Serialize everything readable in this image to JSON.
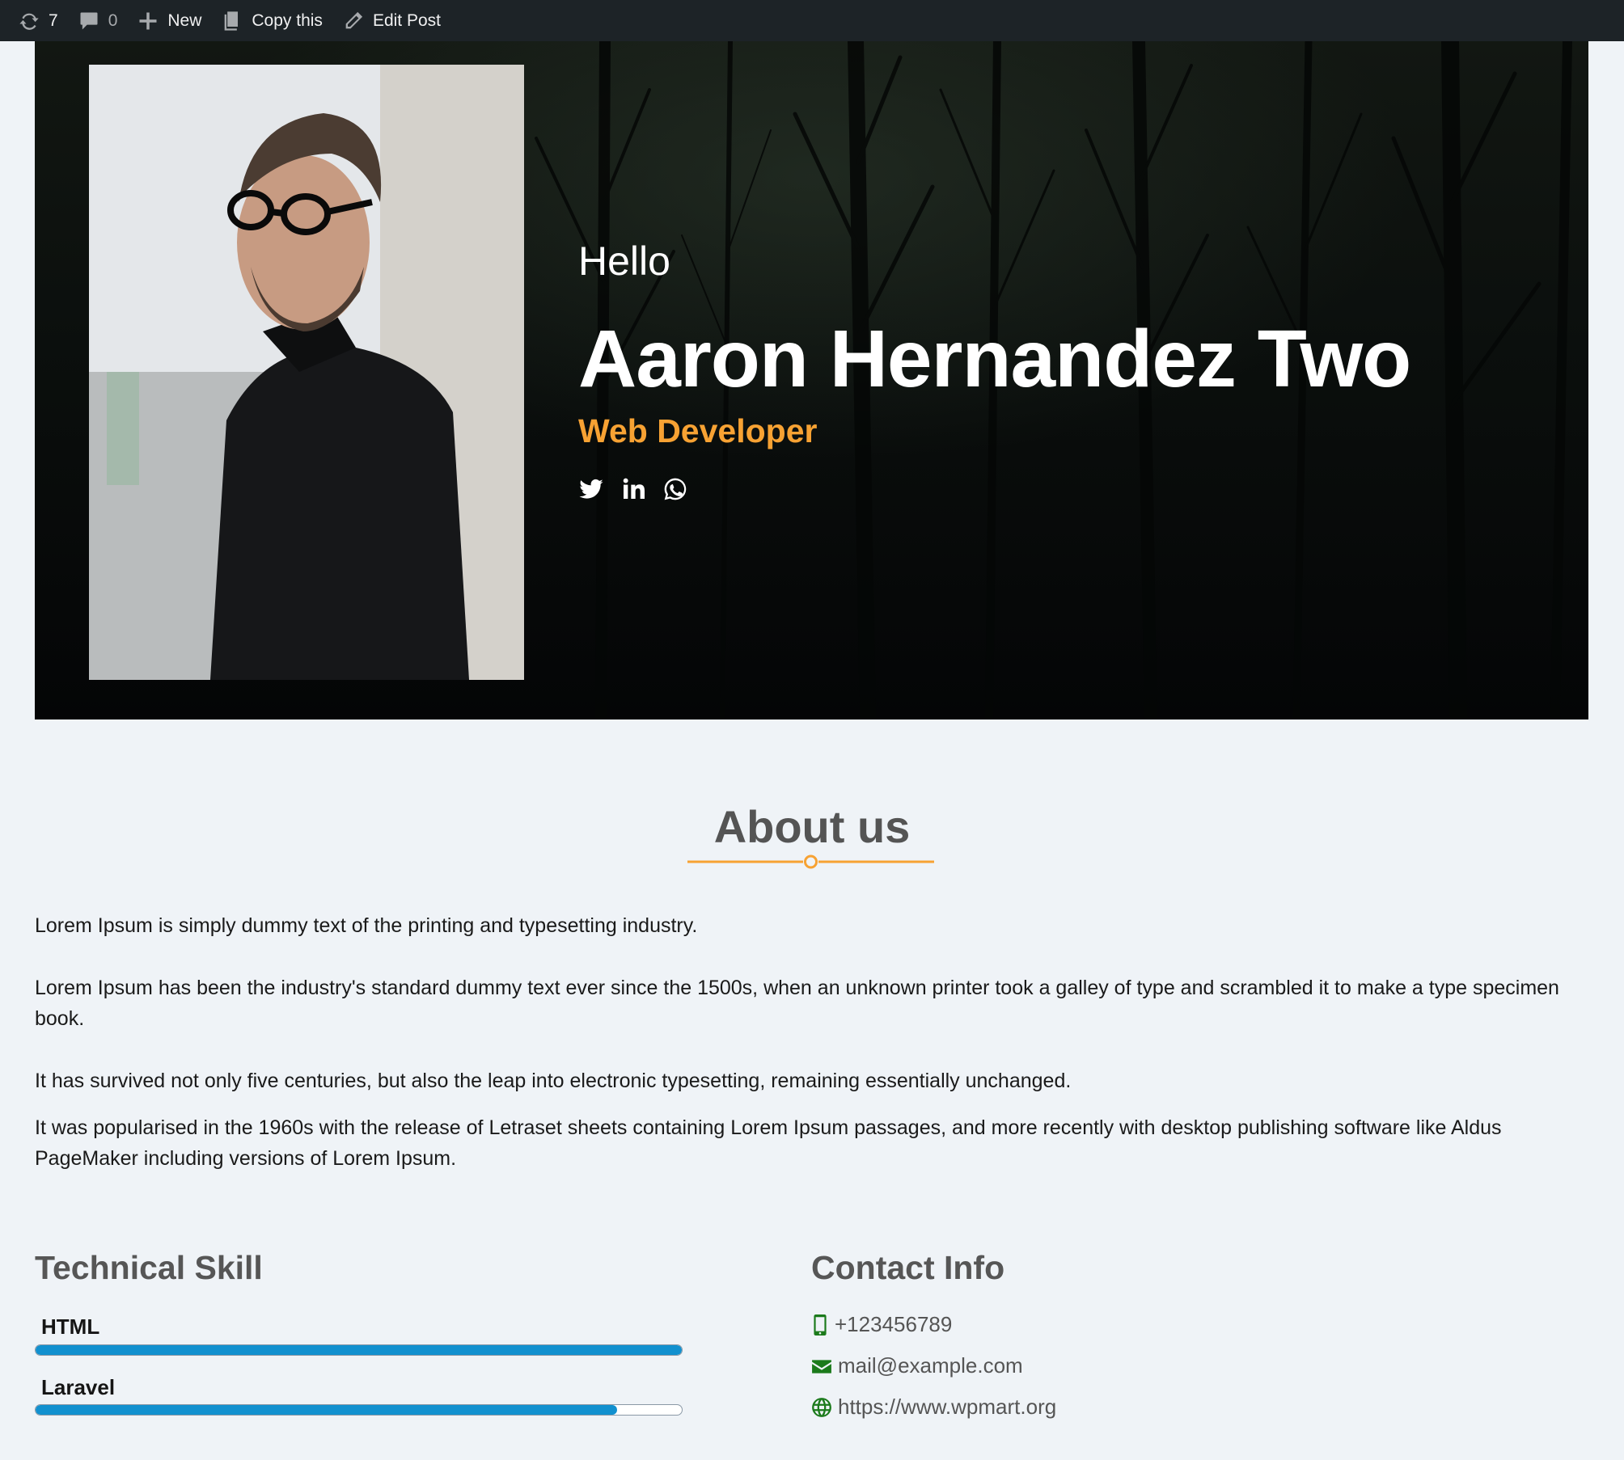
{
  "adminbar": {
    "updates_count": "7",
    "comments_count": "0",
    "new_label": "New",
    "copy_label": "Copy this",
    "edit_label": "Edit Post",
    "icons": [
      "refresh-icon",
      "comment-icon",
      "plus-icon",
      "copy-icon",
      "pencil-icon"
    ]
  },
  "hero": {
    "greeting": "Hello",
    "name": "Aaron Hernandez Two",
    "role": "Web Developer",
    "role_color": "#f7a233",
    "social_icons": [
      "twitter-icon",
      "linkedin-icon",
      "whatsapp-icon"
    ]
  },
  "about": {
    "title": "About us",
    "accent_color": "#f7a233",
    "paragraphs": [
      "Lorem Ipsum is simply dummy text of the printing and typesetting industry.",
      "Lorem Ipsum has been the industry's standard dummy text ever since the 1500s, when an unknown printer took a galley of type and scrambled it to make a type specimen book.",
      "It has survived not only five centuries, but also the leap into electronic typesetting, remaining essentially unchanged.",
      "It was popularised in the 1960s with the release of Letraset sheets containing Lorem Ipsum passages, and more recently with desktop publishing software like Aldus PageMaker including versions of Lorem Ipsum."
    ]
  },
  "skills": {
    "title": "Technical Skill",
    "bar_color": "#1190cf",
    "items": [
      {
        "label": "HTML",
        "level": 1.0
      },
      {
        "label": "Laravel",
        "level": 0.9
      }
    ]
  },
  "contact": {
    "title": "Contact Info",
    "icon_color": "#1b7a1b",
    "phone": "+123456789",
    "email": "mail@example.com",
    "website": "https://www.wpmart.org",
    "icons": [
      "phone-icon",
      "envelope-icon",
      "globe-icon"
    ]
  }
}
